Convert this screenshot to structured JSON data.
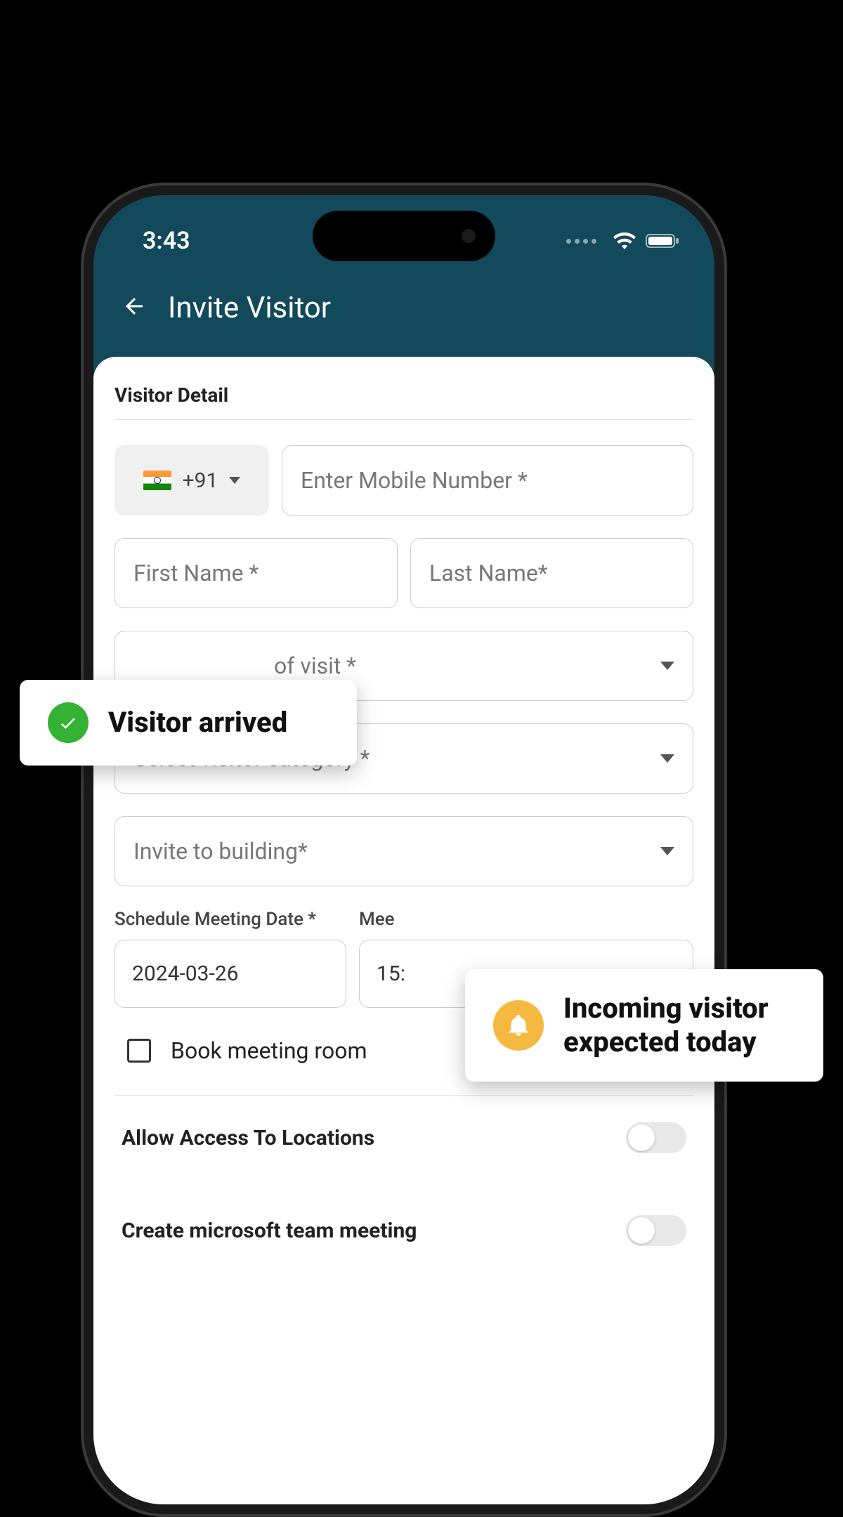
{
  "statusBar": {
    "time": "3:43"
  },
  "appBar": {
    "title": "Invite Visitor"
  },
  "form": {
    "sectionTitle": "Visitor Detail",
    "countryCode": "+91",
    "mobilePlaceholder": "Enter Mobile Number *",
    "firstNamePlaceholder": "First Name *",
    "lastNamePlaceholder": "Last Name*",
    "purposeLabel": "Select purpose of visit *",
    "purposeVisibleFragment": "of visit *",
    "categoryLabel": "Select visitor category *",
    "buildingLabel": "Invite to building*",
    "scheduleDateLabel": "Schedule Meeting Date *",
    "scheduleDateValue": "2024-03-26",
    "meetingTimeLabelFragment": "Mee",
    "meetingTimeValueFragment": "15:",
    "bookMeetingRoom": "Book meeting room",
    "allowAccess": "Allow Access To Locations",
    "createTeams": "Create microsoft team meeting"
  },
  "callouts": {
    "arrived": "Visitor arrived",
    "incoming": "Incoming visitor expected today"
  }
}
